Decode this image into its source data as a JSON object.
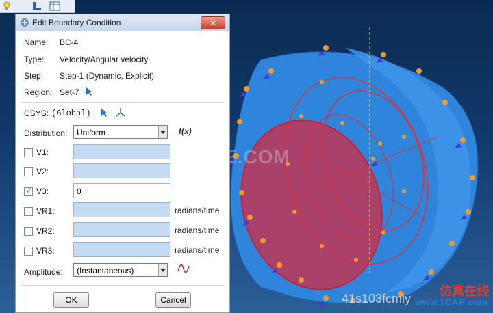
{
  "dialog": {
    "title": "Edit Boundary Condition",
    "close_label": "✕",
    "name_label": "Name:",
    "name_value": "BC-4",
    "type_label": "Type:",
    "type_value": "Velocity/Angular velocity",
    "step_label": "Step:",
    "step_value": "Step-1 (Dynamic, Explicit)",
    "region_label": "Region:",
    "region_value": "Set-7",
    "csys_label": "CSYS:",
    "csys_value": "(Global)",
    "distribution_label": "Distribution:",
    "distribution_value": "Uniform",
    "fx_label": "f(x)",
    "v1_label": "V1:",
    "v2_label": "V2:",
    "v3_label": "V3:",
    "v3_value": "0",
    "vr1_label": "VR1:",
    "vr2_label": "VR2:",
    "vr3_label": "VR3:",
    "unit_radians": "radians/time",
    "amplitude_label": "Amplitude:",
    "amplitude_value": "(Instantaneous)",
    "ok_label": "OK",
    "cancel_label": "Cancel"
  },
  "checks": {
    "v1": false,
    "v2": false,
    "v3": true,
    "vr1": false,
    "vr2": false,
    "vr3": false
  },
  "watermark": "1CAE.COM",
  "credit": "41s103fcmly",
  "brand": "仿真在线",
  "brand_sub": "www.1CAE.com",
  "colors": {
    "part_blue": "#2f84dc",
    "section_red": "#c23a57",
    "viewport_bg": "#0b2a52"
  }
}
